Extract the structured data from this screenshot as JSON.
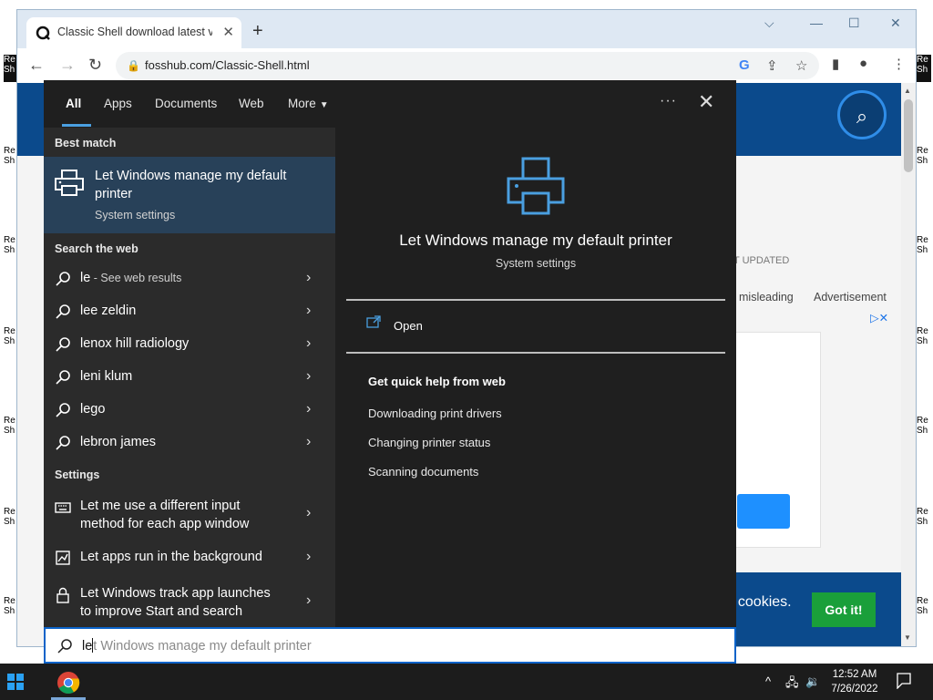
{
  "desktop": {
    "icon_label": "Re Sh"
  },
  "browser": {
    "tab_title": "Classic Shell download latest ver",
    "tab_close": "✕",
    "new_tab": "+",
    "url": "fosshub.com/Classic-Shell.html",
    "window_controls": [
      "⌵",
      "—",
      "☐",
      "✕"
    ]
  },
  "page": {
    "last_updated": "T UPDATED",
    "misleading": "misleading",
    "advertisement": "Advertisement",
    "cookies_text": "f cookies.",
    "got_it": "Got it!"
  },
  "search": {
    "tabs": [
      "All",
      "Apps",
      "Documents",
      "Web",
      "More"
    ],
    "best_match_label": "Best match",
    "best_match": {
      "title": "Let Windows manage my default printer",
      "subtitle": "System settings"
    },
    "web_label": "Search the web",
    "web_results": [
      {
        "text": "le",
        "suffix": " - See web results"
      },
      {
        "text": "lee zeldin",
        "suffix": ""
      },
      {
        "text": "lenox hill radiology",
        "suffix": ""
      },
      {
        "text": "leni klum",
        "suffix": ""
      },
      {
        "text": "lego",
        "suffix": ""
      },
      {
        "text": "lebron james",
        "suffix": ""
      }
    ],
    "settings_label": "Settings",
    "settings": [
      {
        "text": "Let me use a different input method for each app window",
        "icon": "keyboard-icon"
      },
      {
        "text": "Let apps run in the background",
        "icon": "chart-icon"
      },
      {
        "text": "Let Windows track app launches to improve Start and search",
        "icon": "lock-icon"
      }
    ],
    "preview": {
      "title": "Let Windows manage my default printer",
      "subtitle": "System settings",
      "open_label": "Open",
      "help_title": "Get quick help from web",
      "help_links": [
        "Downloading print drivers",
        "Changing printer status",
        "Scanning documents"
      ]
    },
    "query_typed": "le",
    "query_suggestion": "t Windows manage my default printer"
  },
  "taskbar": {
    "time": "12:52 AM",
    "date": "7/26/2022",
    "tray_caret": "^"
  },
  "colors": {
    "accent": "#4a9fe0",
    "best_match_bg": "#284159",
    "panel_bg": "#1f1f1f",
    "left_col_bg": "#2b2b2b",
    "taskbar_bg": "#1c1c1c"
  }
}
